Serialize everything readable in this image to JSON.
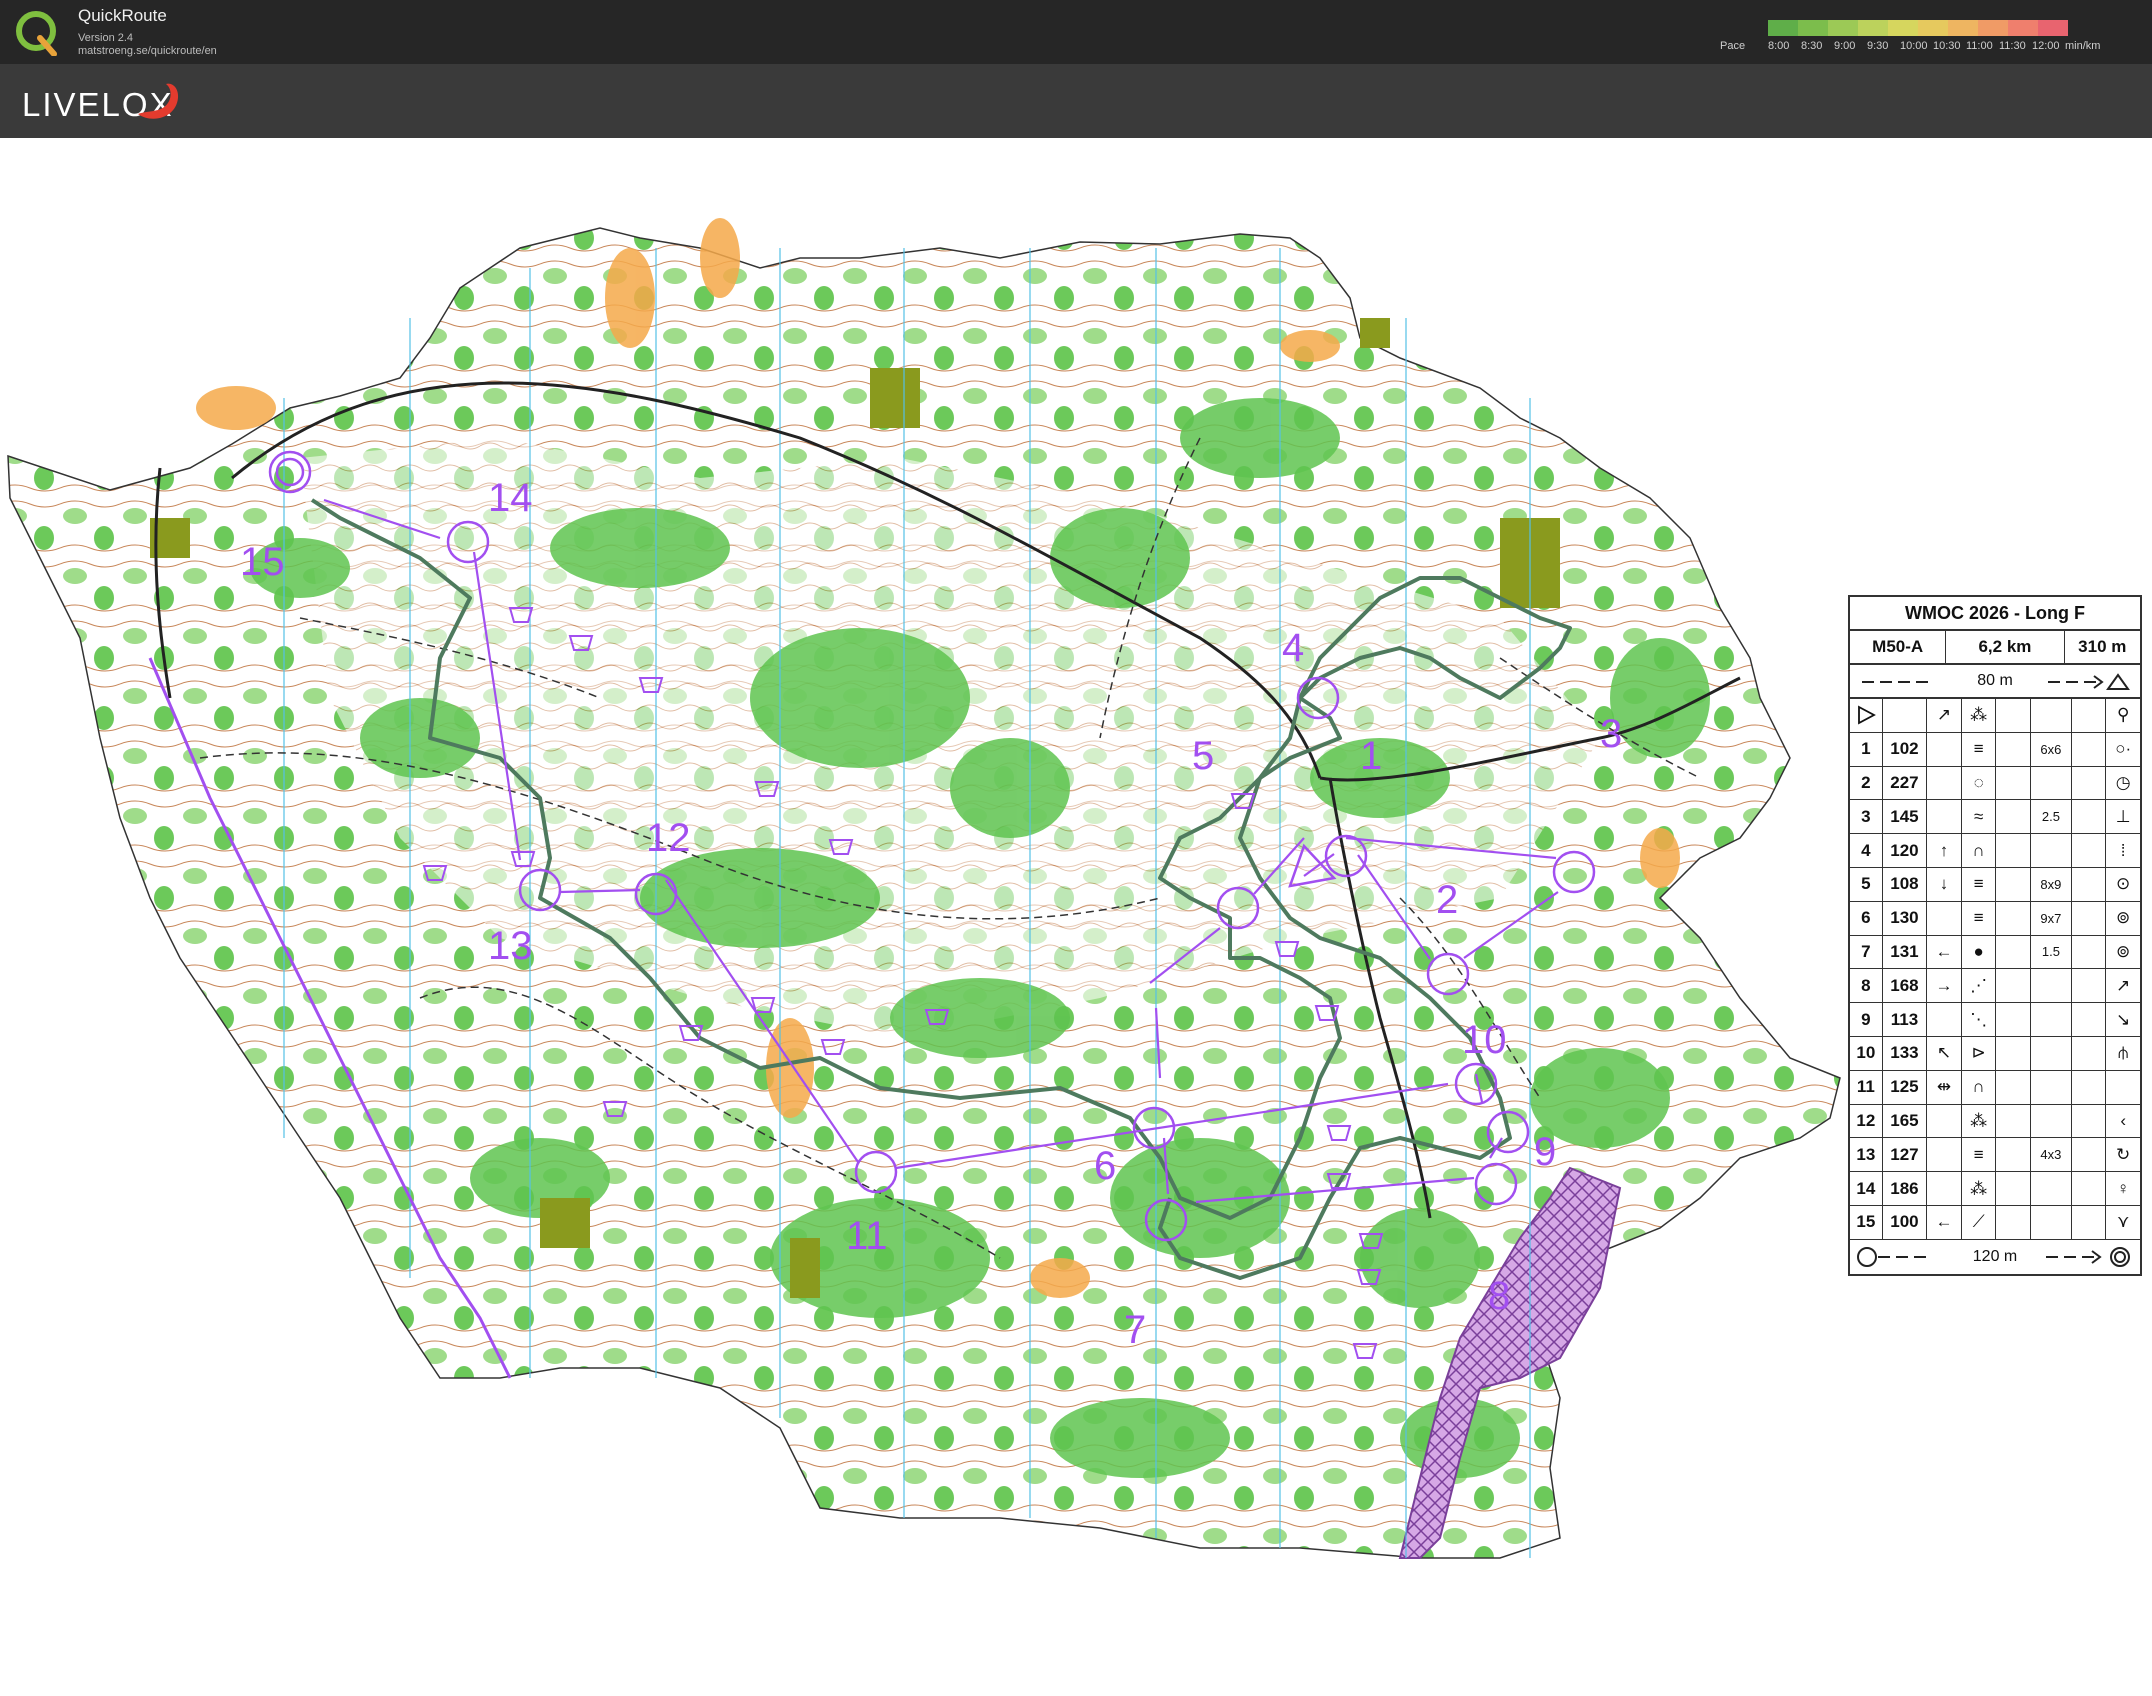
{
  "app": {
    "name": "QuickRoute",
    "version": "Version 2.4",
    "url": "matstroeng.se/quickroute/en",
    "brand": "LIVELOX"
  },
  "pace_scale": {
    "label": "Pace",
    "ticks": [
      "8:00",
      "8:30",
      "9:00",
      "9:30",
      "10:00",
      "10:30",
      "11:00",
      "11:30",
      "12:00"
    ],
    "unit": "min/km",
    "colors": [
      "#5fae49",
      "#7cbd4c",
      "#9cc956",
      "#bcd25c",
      "#d6d65e",
      "#e6c95e",
      "#eeb561",
      "#f09b66",
      "#ef7f6d",
      "#e8646f"
    ]
  },
  "control_description": {
    "title": "WMOC 2026 - Long F",
    "class": "M50-A",
    "length": "6,2 km",
    "climb": "310 m",
    "start_distance": "80 m",
    "finish_distance": "120 m",
    "rows": [
      {
        "num": "1",
        "code": "102",
        "dim": "6x6"
      },
      {
        "num": "2",
        "code": "227",
        "dim": ""
      },
      {
        "num": "3",
        "code": "145",
        "dim": "2.5"
      },
      {
        "num": "4",
        "code": "120",
        "dim": ""
      },
      {
        "num": "5",
        "code": "108",
        "dim": "8x9"
      },
      {
        "num": "6",
        "code": "130",
        "dim": "9x7"
      },
      {
        "num": "7",
        "code": "131",
        "dim": "1.5"
      },
      {
        "num": "8",
        "code": "168",
        "dim": ""
      },
      {
        "num": "9",
        "code": "113",
        "dim": ""
      },
      {
        "num": "10",
        "code": "133",
        "dim": ""
      },
      {
        "num": "11",
        "code": "125",
        "dim": ""
      },
      {
        "num": "12",
        "code": "165",
        "dim": ""
      },
      {
        "num": "13",
        "code": "127",
        "dim": "4x3"
      },
      {
        "num": "14",
        "code": "186",
        "dim": ""
      },
      {
        "num": "15",
        "code": "100",
        "dim": ""
      }
    ]
  },
  "course": {
    "color": "#a24ff0",
    "control_labels": [
      "1",
      "2",
      "3",
      "4",
      "5",
      "6",
      "7",
      "8",
      "9",
      "10",
      "11",
      "12",
      "13",
      "14",
      "15"
    ]
  }
}
